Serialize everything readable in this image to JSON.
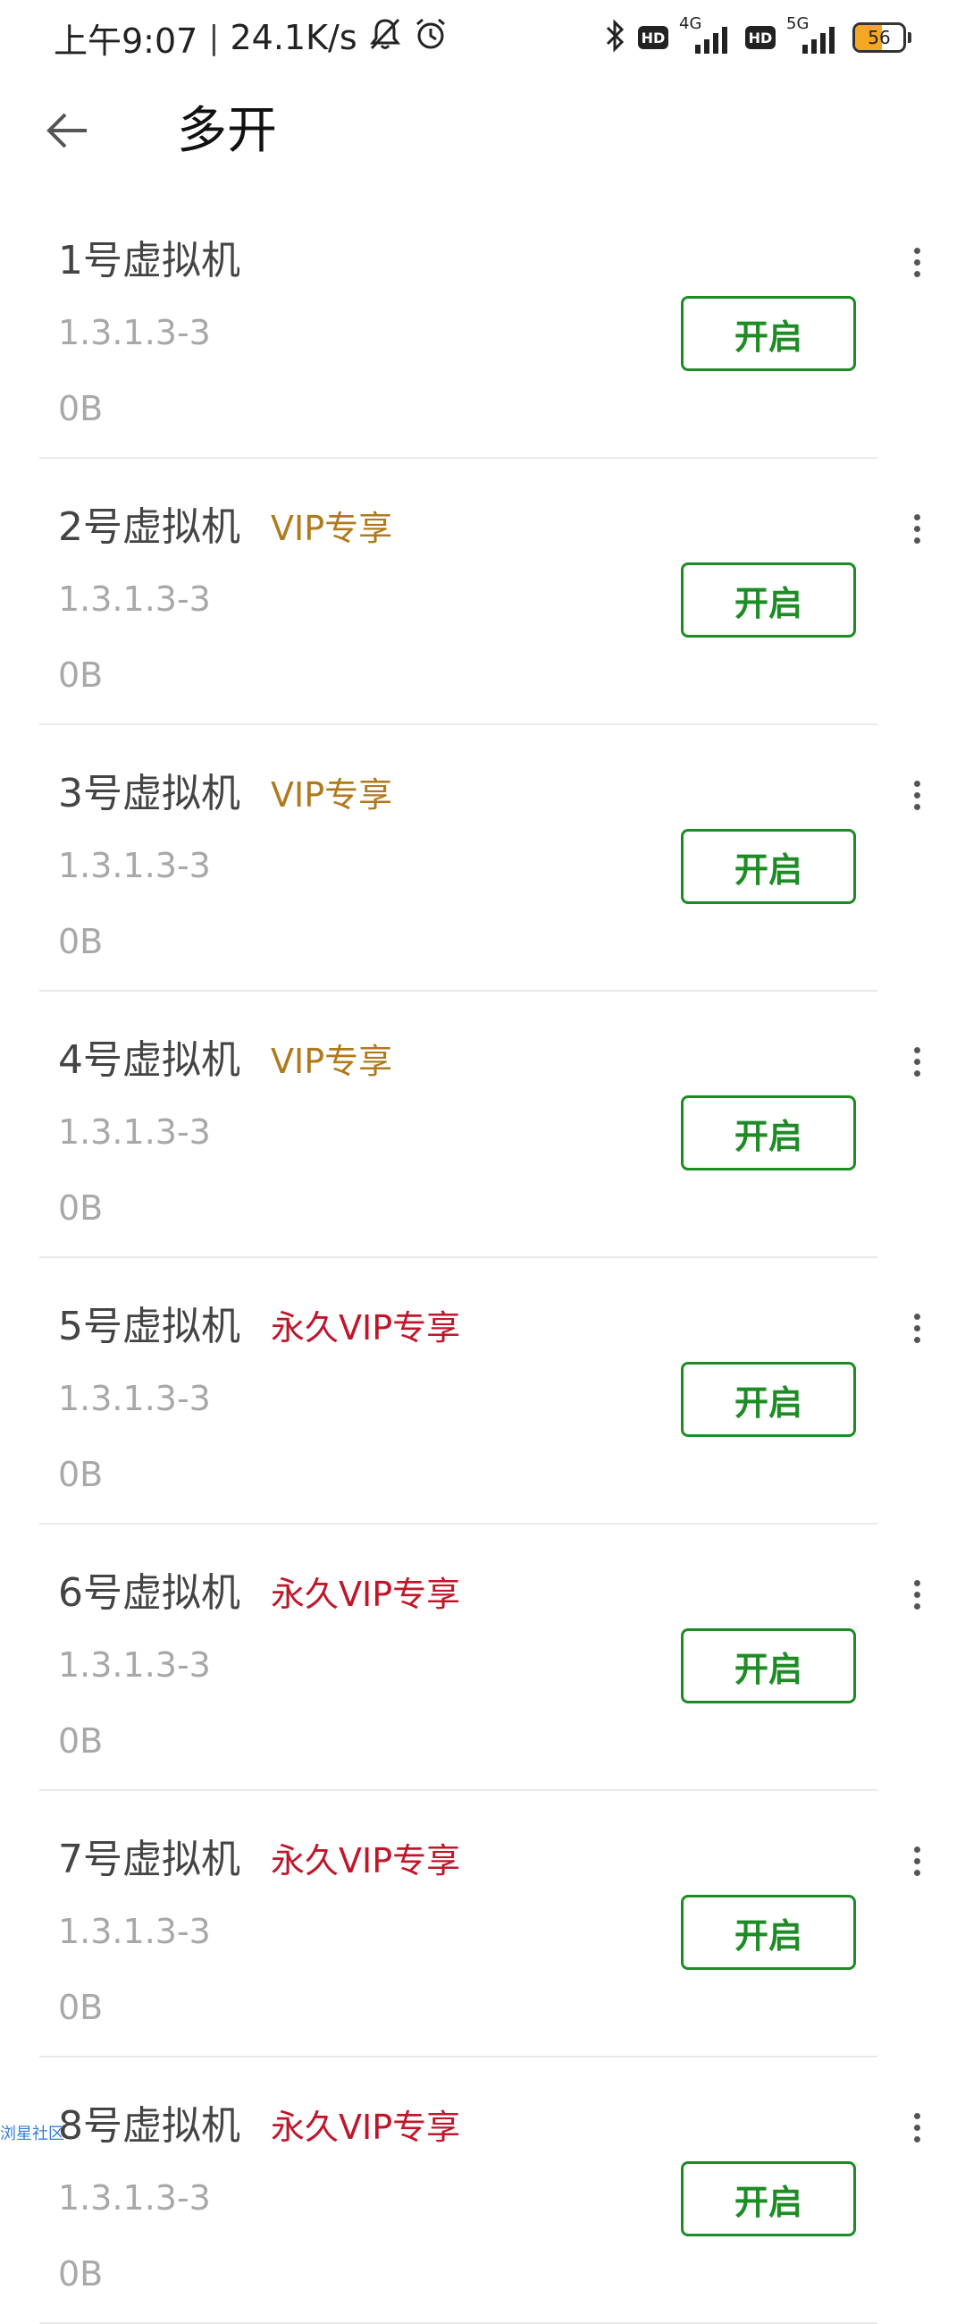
{
  "status_bar": {
    "time": "上午9:07",
    "separator": "|",
    "speed": "24.1K/s",
    "net_1": "4G",
    "net_2": "5G",
    "hd_1": "HD",
    "hd_2": "HD",
    "battery": "56",
    "battery_level": 0.56,
    "battery_color": "#f5a623"
  },
  "app_bar": {
    "title": "多开",
    "back_icon": "arrow-left-icon"
  },
  "colors": {
    "accent_green": "#1e8c25",
    "vip_gold": "#b07a1c",
    "permanent_vip_red": "#c0162a"
  },
  "vm_list": [
    {
      "name": "1号虚拟机",
      "badge": "",
      "badge_type": "none",
      "version": "1.3.1.3-3",
      "size": "0B",
      "button": "开启"
    },
    {
      "name": "2号虚拟机",
      "badge": "VIP专享",
      "badge_type": "vip",
      "version": "1.3.1.3-3",
      "size": "0B",
      "button": "开启"
    },
    {
      "name": "3号虚拟机",
      "badge": "VIP专享",
      "badge_type": "vip",
      "version": "1.3.1.3-3",
      "size": "0B",
      "button": "开启"
    },
    {
      "name": "4号虚拟机",
      "badge": "VIP专享",
      "badge_type": "vip",
      "version": "1.3.1.3-3",
      "size": "0B",
      "button": "开启"
    },
    {
      "name": "5号虚拟机",
      "badge": "永久VIP专享",
      "badge_type": "perm",
      "version": "1.3.1.3-3",
      "size": "0B",
      "button": "开启"
    },
    {
      "name": "6号虚拟机",
      "badge": "永久VIP专享",
      "badge_type": "perm",
      "version": "1.3.1.3-3",
      "size": "0B",
      "button": "开启"
    },
    {
      "name": "7号虚拟机",
      "badge": "永久VIP专享",
      "badge_type": "perm",
      "version": "1.3.1.3-3",
      "size": "0B",
      "button": "开启"
    },
    {
      "name": "8号虚拟机",
      "badge": "永久VIP专享",
      "badge_type": "perm",
      "version": "1.3.1.3-3",
      "size": "0B",
      "button": "开启"
    }
  ],
  "watermark": "浏星社区"
}
